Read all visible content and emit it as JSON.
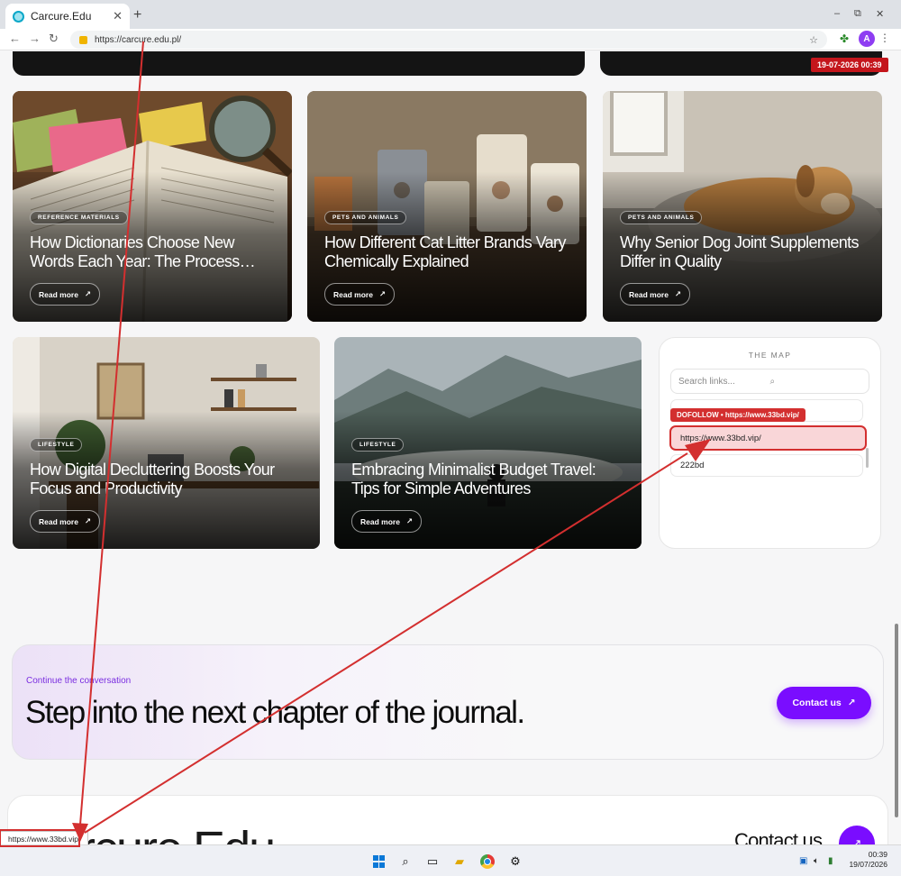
{
  "browser": {
    "tab_title": "Carcure.Edu",
    "tab_close": "✕",
    "new_tab": "+",
    "url": "https://carcure.edu.pl/",
    "window_controls": [
      "–",
      "⧉",
      "✕"
    ],
    "avatar_letter": "A"
  },
  "stamp": "19-07-2026 00:39",
  "articles": [
    {
      "category": "REFERENCE MATERIALS",
      "title": "How Dictionaries Choose New Words Each Year: The Process…",
      "cta": "Read more",
      "scene": "book-desk"
    },
    {
      "category": "PETS AND ANIMALS",
      "title": "How Different Cat Litter Brands Vary Chemically Explained",
      "cta": "Read more",
      "scene": "litter-bags"
    },
    {
      "category": "PETS AND ANIMALS",
      "title": "Why Senior Dog Joint Supplements Differ in Quality",
      "cta": "Read more",
      "scene": "senior-dog"
    },
    {
      "category": "LIFESTYLE",
      "title": "How Digital Decluttering Boosts Your Focus and Productivity",
      "cta": "Read more",
      "scene": "home-office"
    },
    {
      "category": "LIFESTYLE",
      "title": "Embracing Minimalist Budget Travel: Tips for Simple Adventures",
      "cta": "Read more",
      "scene": "mountain-lake"
    }
  ],
  "map": {
    "title": "THE MAP",
    "search_placeholder": "Search links...",
    "dofollow_label": "DOFOLLOW • https://www.33bd.vip/",
    "items": [
      "https://www.33bd.vip/",
      "222bd"
    ]
  },
  "cta": {
    "kicker": "Continue the conversation",
    "headline": "Step into the next chapter of the journal.",
    "button": "Contact us"
  },
  "footer": {
    "brand": "Carcure.Edu",
    "contact": "Contact us"
  },
  "status_url": "https://www.33bd.vip/",
  "taskbar": {
    "time": "00:39",
    "date": "19/07/2026"
  },
  "colors": {
    "accent": "#7a0dff",
    "annotation_red": "#d32f2f",
    "page_bg": "#f6f6f7"
  }
}
